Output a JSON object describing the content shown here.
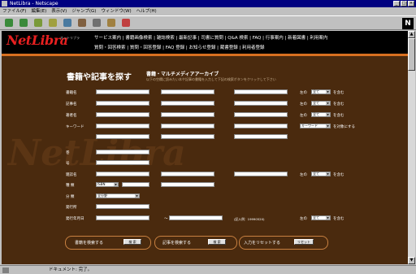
{
  "window": {
    "title": "NetLibra - Netscape"
  },
  "menu": [
    "ファイル(F)",
    "編集(E)",
    "表示(V)",
    "ジャンプ(G)",
    "ウィンドウ(W)",
    "ヘルプ(H)"
  ],
  "header": {
    "logo": "NetLibra",
    "logo_sub": "ネットリブラ",
    "nav_row1": "サービス案内 | 書籍画像検索 | 雑誌検索 | 最新記事 | 司書に質問 | Q&A 検索 | FAQ | 行事案内 | 新着図書 | 利用案内",
    "nav_row2": "質問・回答検索 | 質問・回答登録 | FAQ 登録 | お知らせ登録 | 蔵書登録 | 利用者登録"
  },
  "page": {
    "title": "書籍や記事を探す",
    "subtitle": "書籍・マルチメディアアーカイブ",
    "description": "以下の空欄に読みたい本や記事の書籍を入力して下記の検索ボタンをクリックして下さい",
    "watermark": "NetLibra"
  },
  "form": {
    "labels": {
      "book": "書籍名",
      "article": "記事名",
      "author": "著者名",
      "keyword": "キーワード",
      "volume": "巻",
      "issue": "号",
      "magazine": "雑誌名",
      "type": "種 類",
      "class": "分 類",
      "publisher": "発行所",
      "pubdate": "発行年月日"
    },
    "any_prefix": "左の",
    "contains": "を含む",
    "all_option": "全て",
    "keyword_option": "キーワード",
    "keyword_suffix": "を対象にする",
    "isbn_option": "ISBN",
    "class_option": "全分野",
    "tilde": "〜",
    "date_note": "(記入例：19990520)"
  },
  "buttons": {
    "book_search_label": "書籍を検索する",
    "article_search_label": "記事を検索する",
    "reset_label": "入力をリセットする",
    "search": "検 索",
    "reset": "リセット"
  },
  "status": {
    "text": "ドキュメント: 完了。"
  }
}
